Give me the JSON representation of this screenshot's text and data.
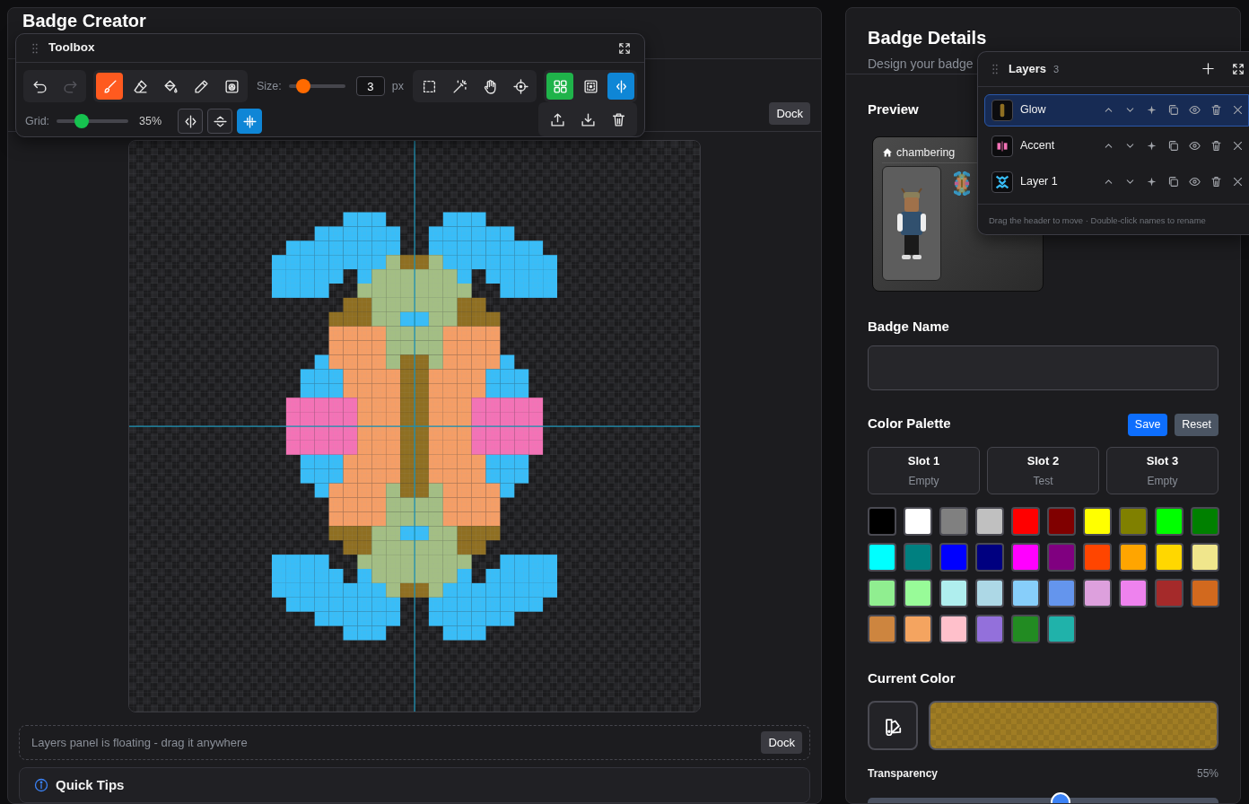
{
  "editor": {
    "title": "Badge Creator",
    "dock_label": "Dock",
    "floating_note": {
      "text": "Layers panel is floating - drag it anywhere",
      "button": "Dock"
    },
    "tips": {
      "title": "Quick Tips"
    }
  },
  "toolbox": {
    "title": "Toolbox",
    "history": [
      {
        "kind": "undo",
        "disabled": false
      },
      {
        "kind": "redo",
        "disabled": true
      }
    ],
    "tools": [
      {
        "kind": "brush",
        "selected": true
      },
      {
        "kind": "eraser",
        "selected": false
      },
      {
        "kind": "fill",
        "selected": false
      },
      {
        "kind": "eyedropper",
        "selected": false
      },
      {
        "kind": "shape",
        "selected": false
      }
    ],
    "size": {
      "label": "Size:",
      "level": 0.26,
      "value": "3",
      "unit": "px"
    },
    "selection_tools": [
      {
        "kind": "select"
      },
      {
        "kind": "wand"
      },
      {
        "kind": "pan"
      },
      {
        "kind": "center"
      }
    ],
    "view_toggles": [
      {
        "kind": "grid",
        "on": true
      },
      {
        "kind": "frame",
        "on": false
      },
      {
        "kind": "mirror",
        "on": true
      }
    ],
    "grid": {
      "label": "Grid:",
      "level": 0.35,
      "reading": "35%"
    },
    "symmetry": [
      {
        "kind": "vertical",
        "on": false
      },
      {
        "kind": "horizontal",
        "on": false
      },
      {
        "kind": "both",
        "on": true
      }
    ],
    "actions": [
      {
        "kind": "export"
      },
      {
        "kind": "import"
      },
      {
        "kind": "clear"
      }
    ]
  },
  "details": {
    "title": "Badge Details",
    "subtitle": "Design your badge",
    "preview": {
      "heading": "Preview",
      "room": "chambering"
    },
    "badge_name": {
      "label": "Badge Name"
    },
    "palette": {
      "heading": "Color Palette",
      "save": "Save",
      "reset": "Reset",
      "slots": [
        {
          "title": "Slot 1",
          "status": "Empty"
        },
        {
          "title": "Slot 2",
          "status": "Test"
        },
        {
          "title": "Slot 3",
          "status": "Empty"
        }
      ],
      "swatches": [
        {
          "color": "#000000"
        },
        {
          "color": "#ffffff"
        },
        {
          "color": "#808080"
        },
        {
          "color": "#c0c0c0"
        },
        {
          "color": "#ff0000"
        },
        {
          "color": "#800000"
        },
        {
          "color": "#ffff00"
        },
        {
          "color": "#808000"
        },
        {
          "color": "#00ff00"
        },
        {
          "color": "#008000"
        },
        {
          "color": "#00ffff"
        },
        {
          "color": "#008080"
        },
        {
          "color": "#0000ff"
        },
        {
          "color": "#000080"
        },
        {
          "color": "#ff00ff"
        },
        {
          "color": "#800080"
        },
        {
          "color": "#ff4500"
        },
        {
          "color": "#ffa500"
        },
        {
          "color": "#ffd700"
        },
        {
          "color": "#f0e68c"
        },
        {
          "color": "#90ee90"
        },
        {
          "color": "#98fb98"
        },
        {
          "color": "#afeeee"
        },
        {
          "color": "#add8e6"
        },
        {
          "color": "#87cefa"
        },
        {
          "color": "#6495ed"
        },
        {
          "color": "#dda0dd"
        },
        {
          "color": "#ee82ee"
        },
        {
          "color": "#a52a2a"
        },
        {
          "color": "#d2691e"
        },
        {
          "color": "#cd853f"
        },
        {
          "color": "#f4a460"
        },
        {
          "color": "#ffc0cb"
        },
        {
          "color": "#9370db"
        },
        {
          "color": "#228b22"
        },
        {
          "color": "#20b2aa"
        }
      ]
    },
    "current": {
      "heading": "Current Color",
      "color": "#a07d24",
      "transparency": {
        "label": "Transparency",
        "reading": "55%",
        "level": 0.55
      }
    }
  },
  "layers": {
    "title": "Layers",
    "count": "3",
    "items": [
      {
        "name": "Glow",
        "kind": "glow",
        "selected": true
      },
      {
        "name": "Accent",
        "kind": "accent",
        "selected": false
      },
      {
        "name": "Layer 1",
        "kind": "base",
        "selected": false
      }
    ],
    "hint": "Drag the header to move · Double-click names to rename"
  }
}
